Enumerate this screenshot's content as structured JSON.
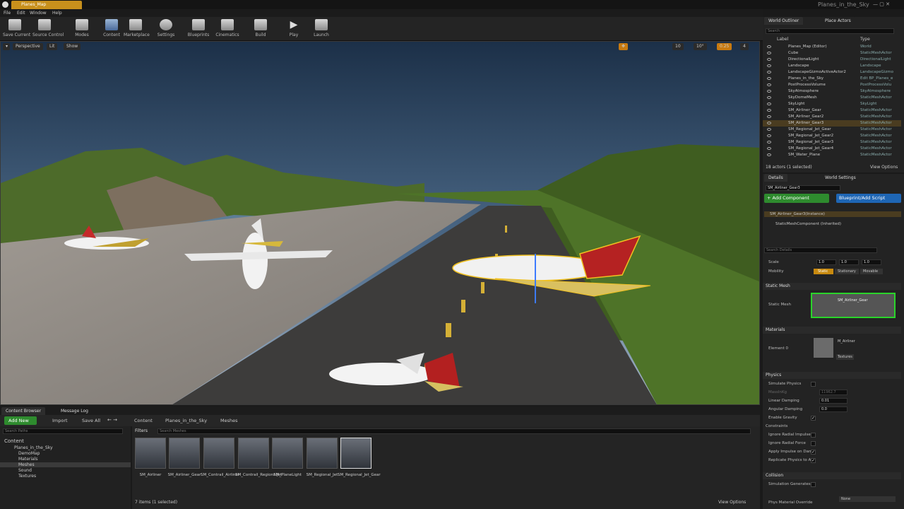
{
  "title": {
    "tab": "Planes_Map",
    "project": "Planes_in_the_Sky"
  },
  "menu": [
    "File",
    "Edit",
    "Window",
    "Help"
  ],
  "toolbar": [
    "Save Current",
    "Source Control",
    "Modes",
    "Content",
    "Marketplace",
    "Settings",
    "Blueprints",
    "Cinematics",
    "Build",
    "Play",
    "Launch"
  ],
  "viewport": {
    "perspective": "Perspective",
    "lit": "Lit",
    "show": "Show",
    "grid": "10",
    "angle": "10°",
    "scale": "0.25",
    "cam": "4"
  },
  "outliner": {
    "tabs": [
      "World Outliner",
      "Place Actors"
    ],
    "search": "Search",
    "col_label": "Label",
    "col_type": "Type",
    "rows": [
      {
        "label": "Planes_Map (Editor)",
        "type": "World"
      },
      {
        "label": "Cube",
        "type": "StaticMeshActor"
      },
      {
        "label": "DirectionalLight",
        "type": "DirectionalLight"
      },
      {
        "label": "Landscape",
        "type": "Landscape"
      },
      {
        "label": "LandscapeGizmoActiveActor2",
        "type": "LandscapeGizmo"
      },
      {
        "label": "Planes_in_the_Sky",
        "type": "Edit BP_Planes_e"
      },
      {
        "label": "PostProcessVolume",
        "type": "PostProcessVolu"
      },
      {
        "label": "SkyAtmosphere",
        "type": "SkyAtmosphere"
      },
      {
        "label": "SkyDomeMesh",
        "type": "StaticMeshActor"
      },
      {
        "label": "SkyLight",
        "type": "SkyLight"
      },
      {
        "label": "SM_Airliner_Gear",
        "type": "StaticMeshActor"
      },
      {
        "label": "SM_Airliner_Gear2",
        "type": "StaticMeshActor"
      },
      {
        "label": "SM_Airliner_Gear3",
        "type": "StaticMeshActor"
      },
      {
        "label": "SM_Regional_Jet_Gear",
        "type": "StaticMeshActor"
      },
      {
        "label": "SM_Regional_Jet_Gear2",
        "type": "StaticMeshActor"
      },
      {
        "label": "SM_Regional_Jet_Gear3",
        "type": "StaticMeshActor"
      },
      {
        "label": "SM_Regional_Jet_Gear4",
        "type": "StaticMeshActor"
      },
      {
        "label": "SM_Water_Plane",
        "type": "StaticMeshActor"
      }
    ],
    "status": "18 actors (1 selected)",
    "view_options": "View Options"
  },
  "details": {
    "tabs": [
      "Details",
      "World Settings"
    ],
    "name": "SM_Airliner_Gear3",
    "add_component": "+ Add Component",
    "blueprint_script": "Blueprint/Add Script",
    "instance": "SM_Airliner_Gear3(Instance)",
    "component": "StaticMeshComponent (Inherited)",
    "search": "Search Details",
    "scale_label": "Scale",
    "scale_vals": [
      "1.0",
      "1.0",
      "1.0"
    ],
    "mobility_label": "Mobility",
    "mobility_opts": [
      "Static",
      "Stationary",
      "Movable"
    ],
    "static_mesh_section": "Static Mesh",
    "static_mesh_label": "Static Mesh",
    "static_mesh_value": "SM_Airliner_Gear",
    "materials_section": "Materials",
    "element0": "Element 0",
    "material_value": "M_Airliner",
    "textures": "Textures",
    "physics_section": "Physics",
    "simulate_physics": "Simulate Physics",
    "mass": "MassInKg",
    "mass_val": "11962.7",
    "linear_damping": "Linear Damping",
    "linear_val": "0.01",
    "angular_damping": "Angular Damping",
    "angular_val": "0.0",
    "enable_gravity": "Enable Gravity",
    "constraints": "Constraints",
    "ignore_impulse": "Ignore Radial Impulse",
    "ignore_force": "Ignore Radial Force",
    "apply_impulse": "Apply Impulse on Dama",
    "replicate": "Replicate Physics to AI",
    "collision_section": "Collision",
    "sim_gen": "Simulation Generates H",
    "phys_override": "Phys Material Override",
    "none": "None"
  },
  "content_browser": {
    "tabs": [
      "Content Browser",
      "Message Log"
    ],
    "add_new": "Add New",
    "import": "Import",
    "save_all": "Save All",
    "breadcrumb": [
      "Content",
      "Planes_in_the_Sky",
      "Meshes"
    ],
    "search_paths": "Search Paths",
    "filters": "Filters",
    "search_meshes": "Search Meshes",
    "tree": [
      "Content",
      "Planes_in_the_Sky",
      "DemoMap",
      "Materials",
      "Meshes",
      "Sound",
      "Textures"
    ],
    "assets": [
      "SM_Airliner",
      "SM_Airliner_Gear",
      "SM_Contrail_Airliner",
      "SM_Contrail_RegionalJet",
      "SM_PlaneLight",
      "SM_Regional_Jet",
      "SM_Regional_Jet_Gear"
    ],
    "status": "7 items (1 selected)",
    "view_options": "View Options"
  }
}
